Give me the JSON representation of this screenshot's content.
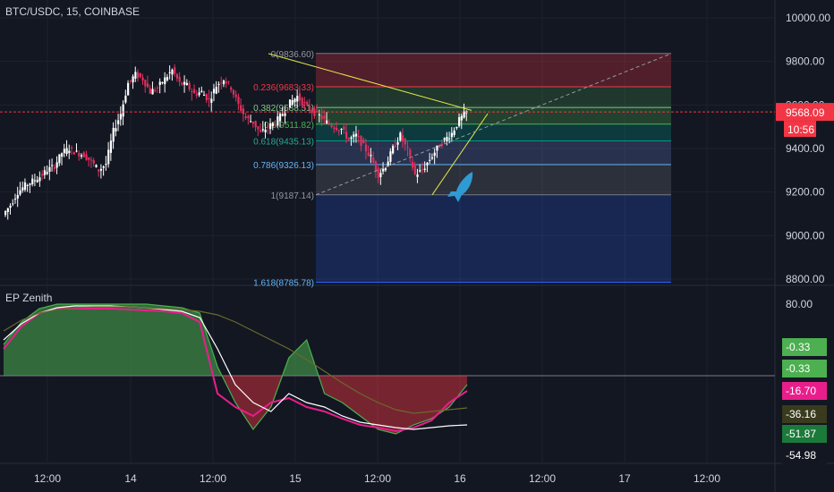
{
  "header": {
    "symbol_label": "BTC/USDC, 15, COINBASE"
  },
  "indicator": {
    "name": "EP Zenith"
  },
  "colors": {
    "background": "#131722",
    "grid": "#1e222d",
    "up_candle": "#ffffff",
    "down_candle": "#e0305d",
    "price_line": "#f23645",
    "fib_line": "#d1d4dc",
    "trend_line": "#e6e84a",
    "rocket": "#2f9bd3"
  },
  "chart_data": [
    {
      "type": "candlestick",
      "title": "BTC/USDC, 15, COINBASE",
      "y_axis": {
        "min": 8800,
        "max": 10000,
        "ticks": [
          10000,
          9800,
          9600,
          9400,
          9200,
          9000,
          8800
        ],
        "tick_labels": [
          "10000.00",
          "9800.00",
          "9600.00",
          "9400.00",
          "9200.00",
          "9000.00",
          "8800.00"
        ]
      },
      "x_axis": {
        "tick_labels": [
          "12:00",
          "14",
          "12:00",
          "15",
          "12:00",
          "16",
          "12:00",
          "17",
          "12:00"
        ]
      },
      "grid": true,
      "last_price": {
        "value": 9568.09,
        "label": "9568.09",
        "countdown": "10:56"
      },
      "price_path": [
        9095,
        9140,
        9200,
        9230,
        9250,
        9270,
        9300,
        9320,
        9380,
        9400,
        9380,
        9370,
        9340,
        9300,
        9330,
        9480,
        9560,
        9700,
        9740,
        9720,
        9660,
        9680,
        9720,
        9760,
        9700,
        9690,
        9650,
        9660,
        9620,
        9690,
        9720,
        9680,
        9600,
        9540,
        9520,
        9470,
        9500,
        9520,
        9560,
        9610,
        9640,
        9600,
        9570,
        9550,
        9520,
        9500,
        9490,
        9440,
        9460,
        9410,
        9360,
        9280,
        9320,
        9400,
        9460,
        9390,
        9280,
        9300,
        9350,
        9400,
        9440,
        9470,
        9530,
        9568
      ],
      "fibonacci": [
        {
          "label": "0(9836.60)",
          "value": 9836.6
        },
        {
          "label": "0.236(9683.33)",
          "value": 9683.33
        },
        {
          "label": "0.382(9588.51)",
          "value": 9588.51
        },
        {
          "label": "0.5(9511.82)",
          "value": 9511.82
        },
        {
          "label": "0.618(9435.13)",
          "value": 9435.13
        },
        {
          "label": "0.786(9326.13)",
          "value": 9326.13
        },
        {
          "label": "1(9187.14)",
          "value": 9187.14
        },
        {
          "label": "1.618(8785.78)",
          "value": 8785.78
        }
      ]
    },
    {
      "type": "area",
      "title": "EP Zenith",
      "y_axis": {
        "tick_labels": [
          "80.00"
        ]
      },
      "zero_line": true,
      "value_labels": [
        {
          "label": "-0.33",
          "color": "#4caf50"
        },
        {
          "label": "-0.33",
          "color": "#4caf50"
        },
        {
          "label": "-16.70",
          "color": "#e91e8c"
        },
        {
          "label": "-36.16",
          "color": "#3a3a1e"
        },
        {
          "label": "-51.87",
          "color": "#1b7a3a"
        },
        {
          "label": "-54.98",
          "color": "#131722"
        }
      ],
      "series": [
        {
          "color": "#4caf50",
          "values": [
            35,
            60,
            75,
            80,
            80,
            80,
            80,
            80,
            80,
            78,
            76,
            70,
            10,
            -30,
            -60,
            -35,
            20,
            40,
            -20,
            -30,
            -45,
            -60,
            -65,
            -55,
            -48,
            -35,
            -10
          ]
        },
        {
          "color": "#e91e8c",
          "values": [
            30,
            55,
            70,
            75,
            75,
            75,
            75,
            74,
            73,
            72,
            70,
            60,
            -20,
            -35,
            -45,
            -30,
            -25,
            -35,
            -40,
            -48,
            -55,
            -58,
            -62,
            -58,
            -50,
            -30,
            -17
          ]
        },
        {
          "color": "#ffffff",
          "values": [
            40,
            58,
            70,
            76,
            78,
            78,
            78,
            77,
            76,
            74,
            72,
            65,
            30,
            -10,
            -30,
            -40,
            -20,
            -30,
            -35,
            -45,
            -52,
            -55,
            -58,
            -60,
            -58,
            -56,
            -55
          ]
        },
        {
          "color": "#6a6a2a",
          "values": [
            50,
            62,
            70,
            74,
            76,
            77,
            77,
            77,
            76,
            75,
            74,
            72,
            68,
            60,
            50,
            40,
            30,
            18,
            5,
            -8,
            -20,
            -30,
            -38,
            -42,
            -40,
            -38,
            -36
          ]
        }
      ]
    }
  ]
}
